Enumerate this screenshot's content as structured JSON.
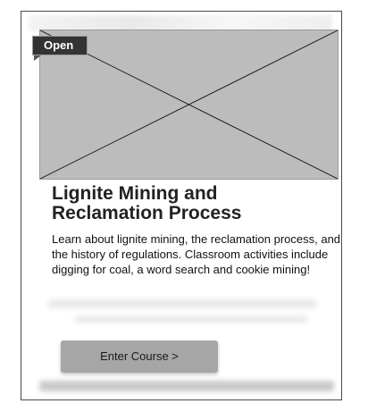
{
  "course_card": {
    "badge_label": "Open",
    "image_icon": "image-placeholder-icon",
    "title_line1": "Lignite Mining and",
    "title_line2": "Reclamation Process",
    "description": "Learn about lignite mining, the reclamation process, and the history of regulations. Classroom activities include digging for coal, a word search and cookie mining!",
    "button_label": "Enter Course >"
  },
  "colors": {
    "badge_background": "#333333",
    "image_placeholder": "#bcbcbc",
    "button_background": "#a6a6a6",
    "card_border": "#4a4a4a"
  }
}
